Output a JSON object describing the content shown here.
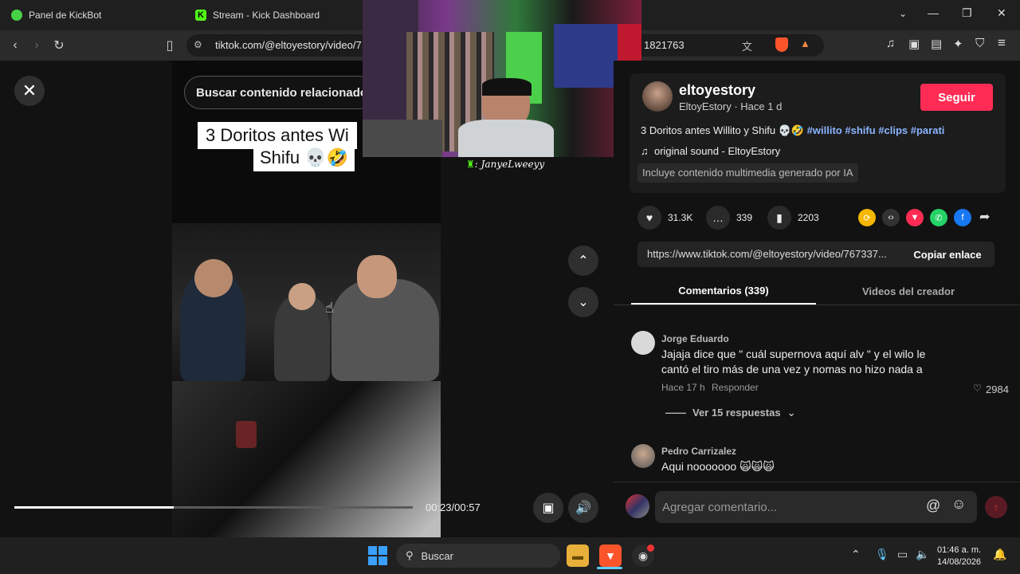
{
  "browser": {
    "tabs": [
      {
        "title": "Panel de KickBot"
      },
      {
        "title": "Stream - Kick Dashboard"
      }
    ],
    "url": "tiktok.com/@eltoyestory/video/7",
    "url_tail": "1821763",
    "window_controls": {
      "minimize": "—",
      "maximize": "❐",
      "close": "✕"
    }
  },
  "video": {
    "search_placeholder": "Buscar contenido relacionado",
    "caption_line1": "3 Doritos antes Wi",
    "caption_line2": "Shifu 💀🤣",
    "progress": 0.4,
    "time": "00:23/00:57",
    "webcam_label": "JanyeLweeyy",
    "webcam_prefix": ": "
  },
  "post": {
    "username": "eltoyestory",
    "subline": "EltoyEstory · Hace 1 d",
    "follow_label": "Seguir",
    "description_text": "3 Doritos antes Willito y Shifu 💀🤣 ",
    "hashtags": [
      "#willito",
      "#shifu",
      "#clips",
      "#parati"
    ],
    "music": "original sound - EltoyEstory",
    "ai_badge": "Incluye contenido multimedia generado por IA",
    "likes": "31.3K",
    "comments": "339",
    "saves": "2203",
    "share_link": "https://www.tiktok.com/@eltoyestory/video/767337...",
    "copy_label": "Copiar enlace"
  },
  "tabs": {
    "comments": "Comentarios (339)",
    "creator_videos": "Videos del creador"
  },
  "comments": [
    {
      "author": "Jorge Eduardo",
      "line1": "Jajaja dice que \" cuál supernova aquí alv \" y el wilo le",
      "line2": "cantó el tiro más de una vez y nomas no hizo nada a",
      "time": "Hace 17 h",
      "reply_label": "Responder",
      "likes": "2984",
      "view_replies": "Ver 15 respuestas"
    },
    {
      "author": "Pedro Carrizalez",
      "line1": "Aqui nooooooo 🙀🙀🙀"
    }
  ],
  "comment_input": {
    "placeholder": "Agregar comentario..."
  },
  "taskbar": {
    "search_label": "Buscar",
    "time": "01:46 a. m.",
    "date": "14/08/2026"
  },
  "colors": {
    "accent": "#fe2c55",
    "hashtag": "#8ab4ff",
    "background": "#121212"
  }
}
